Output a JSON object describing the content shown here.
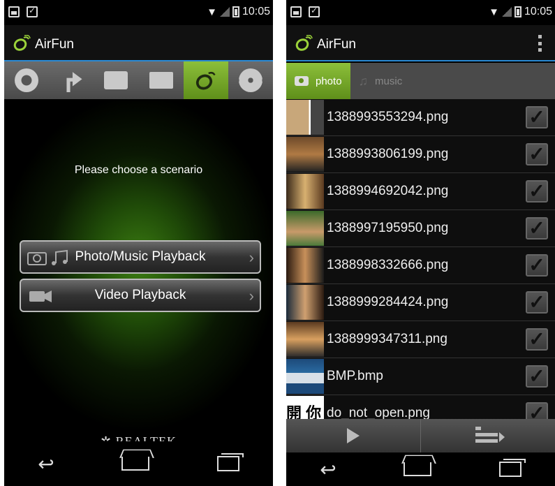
{
  "status": {
    "time": "10:05"
  },
  "app": {
    "title": "AirFun"
  },
  "left": {
    "tabs": [
      "remote-control",
      "share",
      "video",
      "usb-folder",
      "airfun",
      "settings"
    ],
    "prompt": "Please choose a scenario",
    "buttons": {
      "photo_music": "Photo/Music Playback",
      "video": "Video Playback"
    },
    "brand": "REALTEK"
  },
  "right": {
    "media_tabs": {
      "photo": "photo",
      "music": "music"
    },
    "files": [
      {
        "name": "1388993553294.png",
        "checked": true
      },
      {
        "name": "1388993806199.png",
        "checked": true
      },
      {
        "name": "1388994692042.png",
        "checked": true
      },
      {
        "name": "1388997195950.png",
        "checked": true
      },
      {
        "name": "1388998332666.png",
        "checked": true
      },
      {
        "name": "1388999284424.png",
        "checked": true
      },
      {
        "name": "1388999347311.png",
        "checked": true
      },
      {
        "name": "BMP.bmp",
        "checked": true
      },
      {
        "name": "do_not_open.png",
        "checked": true
      }
    ],
    "partial_thumb_text": "開 你"
  },
  "colors": {
    "accent_blue": "#2a8ad4",
    "accent_green": "#8cbf3a"
  }
}
